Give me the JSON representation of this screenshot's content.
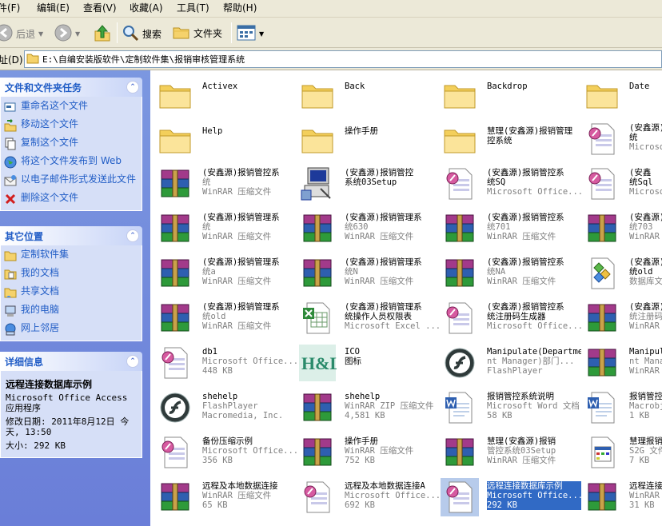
{
  "menu": [
    "件(F)",
    "编辑(E)",
    "查看(V)",
    "收藏(A)",
    "工具(T)",
    "帮助(H)"
  ],
  "toolbar": {
    "back": "后退",
    "search": "搜索",
    "folders": "文件夹"
  },
  "address": {
    "label": "址(D)",
    "path": "E:\\自编安装版软件\\定制软件集\\报销审核管理系统"
  },
  "tasks_panel": {
    "title": "文件和文件夹任务",
    "items": [
      "重命名这个文件",
      "移动这个文件",
      "复制这个文件",
      "将这个文件发布到 Web",
      "以电子邮件形式发送此文件",
      "删除这个文件"
    ]
  },
  "places_panel": {
    "title": "其它位置",
    "items": [
      "定制软件集",
      "我的文档",
      "共享文档",
      "我的电脑",
      "网上邻居"
    ]
  },
  "details_panel": {
    "title": "详细信息",
    "name": "远程连接数据库示例",
    "type": "Microsoft Office Access 应用程序",
    "modified": "修改日期: 2011年8月12日 今天, 13:50",
    "size": "大小: 292 KB"
  },
  "files": [
    {
      "name": "Activex",
      "sub1": "",
      "sub2": "",
      "icon": "folder"
    },
    {
      "name": "Back",
      "sub1": "",
      "sub2": "",
      "icon": "folder"
    },
    {
      "name": "Backdrop",
      "sub1": "",
      "sub2": "",
      "icon": "folder"
    },
    {
      "name": "Date",
      "sub1": "",
      "sub2": "",
      "icon": "folder"
    },
    {
      "name": "Help",
      "sub1": "",
      "sub2": "",
      "icon": "folder"
    },
    {
      "name": "操作手册",
      "sub1": "",
      "sub2": "",
      "icon": "folder"
    },
    {
      "name": "慧理(安鑫源)报销管理",
      "sub1": "控系统",
      "sub2": "",
      "icon": "folder"
    },
    {
      "name": "(安鑫源)",
      "sub1": "统",
      "sub2": "Microsof",
      "icon": "access"
    },
    {
      "name": "(安鑫源)报销管控系",
      "sub1": "统",
      "sub2": "WinRAR 压缩文件",
      "icon": "rar"
    },
    {
      "name": "(安鑫源)报销管控",
      "sub1": "系统03Setup",
      "sub2": "",
      "icon": "setup"
    },
    {
      "name": "(安鑫源)报销管控系",
      "sub1": "统SQ",
      "sub2": "Microsoft Office...",
      "icon": "access"
    },
    {
      "name": "(安鑫",
      "sub1": "统Sql",
      "sub2": "Microsof",
      "icon": "access"
    },
    {
      "name": "(安鑫源)报销管理系",
      "sub1": "统",
      "sub2": "WinRAR 压缩文件",
      "icon": "rar"
    },
    {
      "name": "(安鑫源)报销管理系",
      "sub1": "统630",
      "sub2": "WinRAR 压缩文件",
      "icon": "rar"
    },
    {
      "name": "(安鑫源)报销管控系",
      "sub1": "统701",
      "sub2": "WinRAR 压缩文件",
      "icon": "rar"
    },
    {
      "name": "(安鑫源)",
      "sub1": "统703",
      "sub2": "WinRAR",
      "icon": "rar"
    },
    {
      "name": "(安鑫源)报销管理系",
      "sub1": "统a",
      "sub2": "WinRAR 压缩文件",
      "icon": "rar"
    },
    {
      "name": "(安鑫源)报销管理系",
      "sub1": "统N",
      "sub2": "WinRAR 压缩文件",
      "icon": "rar"
    },
    {
      "name": "(安鑫源)报销管控系",
      "sub1": "统NA",
      "sub2": "WinRAR 压缩文件",
      "icon": "rar"
    },
    {
      "name": "(安鑫源)",
      "sub1": "统old",
      "sub2": "数据库文",
      "icon": "db"
    },
    {
      "name": "(安鑫源)报销管理系",
      "sub1": "统old",
      "sub2": "WinRAR 压缩文件",
      "icon": "rar"
    },
    {
      "name": "(安鑫源)报销管理系",
      "sub1": "统操作人员权限表",
      "sub2": "Microsoft Excel ...",
      "icon": "excel"
    },
    {
      "name": "(安鑫源)报销管控系",
      "sub1": "统注册码生成器",
      "sub2": "Microsoft Office...",
      "icon": "access"
    },
    {
      "name": "(安鑫源)",
      "sub1": "统注册码",
      "sub2": "WinRAR",
      "icon": "rar"
    },
    {
      "name": "db1",
      "sub1": "Microsoft Office...",
      "sub2": "448 KB",
      "icon": "access"
    },
    {
      "name": "ICO",
      "sub1": "图标",
      "sub2": "",
      "icon": "hl"
    },
    {
      "name": "Manipulate(Departme",
      "sub1": "nt Manager)部门...",
      "sub2": "FlashPlayer",
      "icon": "flash"
    },
    {
      "name": "Manipulat",
      "sub1": "nt Manag",
      "sub2": "WinRAR",
      "icon": "rar"
    },
    {
      "name": "shehelp",
      "sub1": "FlashPlayer",
      "sub2": "Macromedia, Inc.",
      "icon": "flash"
    },
    {
      "name": "shehelp",
      "sub1": "WinRAR ZIP 压缩文件",
      "sub2": "4,581 KB",
      "icon": "rar"
    },
    {
      "name": "报销管控系统说明",
      "sub1": "Microsoft Word 文档",
      "sub2": "58 KB",
      "icon": "word"
    },
    {
      "name": "报销管控",
      "sub1": "Macrobje",
      "sub2": "1 KB",
      "icon": "word"
    },
    {
      "name": "备份压缩示例",
      "sub1": "Microsoft Office...",
      "sub2": "356 KB",
      "icon": "access"
    },
    {
      "name": "操作手册",
      "sub1": "WinRAR 压缩文件",
      "sub2": "752 KB",
      "icon": "rar"
    },
    {
      "name": "慧理(安鑫源)报销",
      "sub1": "管控系统03Setup",
      "sub2": "WinRAR 压缩文件",
      "icon": "rar"
    },
    {
      "name": "慧理报销",
      "sub1": "S2G 文件",
      "sub2": "7 KB",
      "icon": "grid"
    },
    {
      "name": "远程及本地数据连接",
      "sub1": "WinRAR 压缩文件",
      "sub2": "65 KB",
      "icon": "rar"
    },
    {
      "name": "远程及本地数据连接A",
      "sub1": "Microsoft Office...",
      "sub2": "692 KB",
      "icon": "access"
    },
    {
      "name": "远程连接数据库示例",
      "sub1": "Microsoft Office...",
      "sub2": "292 KB",
      "icon": "access",
      "selected": true
    },
    {
      "name": "远程连接",
      "sub1": "WinRAR",
      "sub2": "31 KB",
      "icon": "rar"
    }
  ]
}
